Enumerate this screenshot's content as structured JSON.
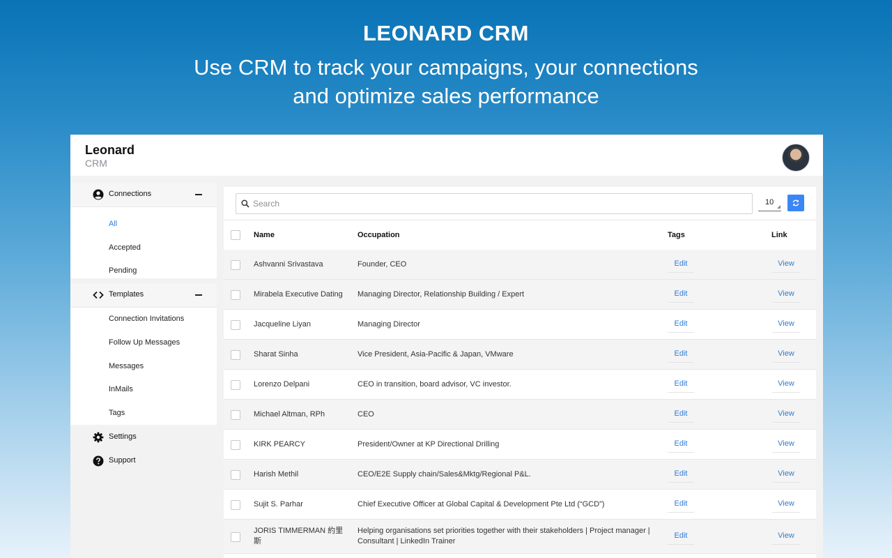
{
  "hero": {
    "title": "LEONARD CRM",
    "subtitle_line1": "Use CRM to track your campaigns, your connections",
    "subtitle_line2": "and optimize sales performance"
  },
  "app": {
    "brand_name": "Leonard",
    "brand_sub": "CRM"
  },
  "sidebar": {
    "connections_label": "Connections",
    "connections_items": [
      "All",
      "Accepted",
      "Pending"
    ],
    "templates_label": "Templates",
    "templates_items": [
      "Connection Invitations",
      "Follow Up Messages",
      "Messages",
      "InMails",
      "Tags"
    ],
    "settings_label": "Settings",
    "support_label": "Support"
  },
  "toolbar": {
    "search_placeholder": "Search",
    "page_size": "10"
  },
  "table": {
    "headers": {
      "name": "Name",
      "occupation": "Occupation",
      "tags": "Tags",
      "link": "Link"
    },
    "edit_label": "Edit",
    "view_label": "View",
    "rows": [
      {
        "name": "Ashvanni Srivastava",
        "occupation": "Founder, CEO"
      },
      {
        "name": "Mirabela Executive Dating",
        "occupation": "Managing Director, Relationship Building / Expert"
      },
      {
        "name": "Jacqueline Liyan",
        "occupation": "Managing Director"
      },
      {
        "name": "Sharat Sinha",
        "occupation": "Vice President, Asia-Pacific & Japan, VMware"
      },
      {
        "name": "Lorenzo Delpani",
        "occupation": "CEO in transition, board advisor, VC investor."
      },
      {
        "name": "Michael Altman, RPh",
        "occupation": "CEO"
      },
      {
        "name": "KIRK PEARCY",
        "occupation": "President/Owner at KP Directional Drilling"
      },
      {
        "name": "Harish Methil",
        "occupation": "CEO/E2E Supply chain/Sales&Mktg/Regional P&L."
      },
      {
        "name": "Sujit S. Parhar",
        "occupation": "Chief Executive Officer at Global Capital & Development Pte Ltd (“GCD”)"
      },
      {
        "name": "JORIS TIMMERMAN 約里斯",
        "occupation": "Helping organisations set priorities together with their stakeholders | Project manager | Consultant | LinkedIn Trainer"
      }
    ]
  },
  "colors": {
    "accent": "#2f7cd4",
    "refresh_button": "#3b86f5"
  }
}
